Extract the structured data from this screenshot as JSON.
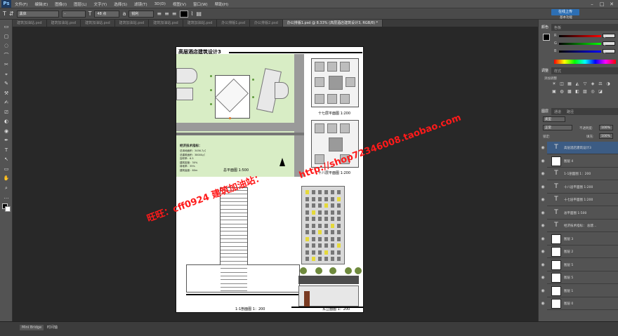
{
  "menubar": {
    "logo": "Ps",
    "items": [
      "文件(F)",
      "编辑(E)",
      "图像(I)",
      "图层(L)",
      "文字(Y)",
      "选择(S)",
      "滤镜(T)",
      "3D(D)",
      "视图(V)",
      "窗口(W)",
      "帮助(H)"
    ],
    "minimize": "–",
    "maximize": "□",
    "close": "✕"
  },
  "options": {
    "tool_icon": "T",
    "orient_icon": "⇵",
    "font_family": "黑体",
    "font_style": "-",
    "size_icon": "T",
    "font_size": "48 点",
    "aa_icon": "a",
    "aa_mode": "锐利",
    "color_swatch": "#000000",
    "upload_label": "在线上传",
    "upload_sub": "基本功能"
  },
  "doc_tabs": [
    {
      "label": "建筑加油站.psd",
      "active": false
    },
    {
      "label": "建筑加油站.psd",
      "active": false
    },
    {
      "label": "建筑加油站.psd",
      "active": false
    },
    {
      "label": "建筑加油站.psd",
      "active": false
    },
    {
      "label": "建筑加油站.psd",
      "active": false
    },
    {
      "label": "建筑加油站.psd",
      "active": false
    },
    {
      "label": "办公排版1.psd",
      "active": false
    },
    {
      "label": "办公排版2.psd",
      "active": false
    },
    {
      "label": "办公排版1.psd @ 8.33% (高层酒店建筑设计3, RGB/8) *",
      "active": true
    }
  ],
  "tools": [
    "▭",
    "▢",
    "◌",
    "⌒",
    "✂",
    "⌖",
    "✎",
    "⚒",
    "✍",
    "⎚",
    "◐",
    "◉",
    "✒",
    "T",
    "↖",
    "▭",
    "✋",
    "⌕",
    "…"
  ],
  "document": {
    "title": "高层酒店建筑设计3",
    "site_plan_label": "总平面图 1:500",
    "plan_17": "十七层平面图 1:200",
    "plan_18": "十八层平面图 1:200",
    "section_label": "1-1剖面图 1：200",
    "elevation_label": "东立面图 1：200",
    "econ_header": "经济技术指标：",
    "econ_lines": [
      "总用地面积：3456.7㎡",
      "总建筑面积：38000㎡",
      "容积率：6.5",
      "建筑密度：30%",
      "绿地率：35%",
      "建筑高度：80m"
    ]
  },
  "watermark": {
    "left": "旺旺：cff0924 建筑加油站：",
    "right": "http://shop72346008.taobao.com"
  },
  "panels": {
    "color_tabs": [
      "颜色",
      "色板"
    ],
    "rgb": [
      {
        "label": "R",
        "value": "0",
        "color": "#d33"
      },
      {
        "label": "G",
        "value": "0",
        "color": "#3a3"
      },
      {
        "label": "B",
        "value": "0",
        "color": "#36c"
      }
    ],
    "adj_tabs": [
      "调整",
      "样式"
    ],
    "adj_title": "添加调整",
    "adj_icons": [
      "☀",
      "◫",
      "▦",
      "◭",
      "▽",
      "◈",
      "⚖",
      "◑",
      "▣",
      "◍",
      "▩",
      "◧",
      "▨",
      "◎",
      "◪"
    ],
    "layer_tabs": [
      "图层",
      "通道",
      "路径"
    ],
    "filter_label": "类型",
    "blend_mode": "正常",
    "opacity_label": "不透明度:",
    "opacity": "100%",
    "lock_label": "锁定:",
    "fill_label": "填充:",
    "fill": "100%"
  },
  "layers": [
    {
      "name": "高层酒店建筑设计3",
      "type": "text",
      "selected": true
    },
    {
      "name": "图层 4",
      "type": "image",
      "selected": false
    },
    {
      "name": "1-1剖面图 1：200",
      "type": "text",
      "selected": false
    },
    {
      "name": "十八层平面图 1:200",
      "type": "text",
      "selected": false
    },
    {
      "name": "十七层平面图 1:200",
      "type": "text",
      "selected": false
    },
    {
      "name": "总平面图 1:500",
      "type": "text",
      "selected": false
    },
    {
      "name": "经济技术指标： 总建…",
      "type": "text",
      "selected": false
    },
    {
      "name": "图层 3",
      "type": "image",
      "selected": false
    },
    {
      "name": "图层 2",
      "type": "image",
      "selected": false
    },
    {
      "name": "图层 5",
      "type": "image",
      "selected": false
    },
    {
      "name": "图层 5",
      "type": "image",
      "selected": false
    },
    {
      "name": "图层 1",
      "type": "image",
      "selected": false
    },
    {
      "name": "图层 0",
      "type": "image",
      "selected": false
    }
  ],
  "status": {
    "tabs": [
      "Mini Bridge",
      "时间轴"
    ]
  }
}
